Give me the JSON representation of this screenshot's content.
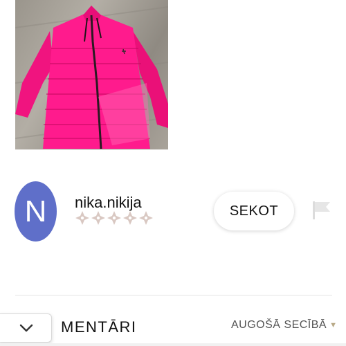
{
  "listing": {
    "photo_subject": "pink puffer jacket"
  },
  "seller": {
    "avatar_letter": "N",
    "username": "nika.nikija",
    "rating_stars": 5,
    "avatar_color": "#5f6fc9",
    "star_color": "#d9c8c2"
  },
  "actions": {
    "follow_label": "SEKOT",
    "report_icon": "flag-icon"
  },
  "comments": {
    "title": "MENTĀRI",
    "sort_label": "AUGOŠĀ SECĪBĀ",
    "sort_icon": "caret-down-icon",
    "collapse_icon": "chevron-down-icon"
  }
}
